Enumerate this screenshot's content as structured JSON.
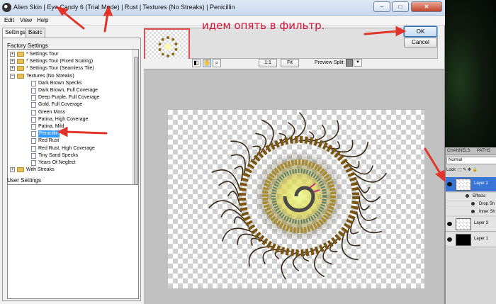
{
  "window": {
    "title": "Alien Skin | Eye Candy 6 (Trial Mode) | Rust | Textures (No Streaks) | Penicillin",
    "controls": {
      "minimize": "–",
      "maximize": "□",
      "close": "✕"
    }
  },
  "menu": {
    "items": [
      "Edit",
      "View",
      "Help"
    ]
  },
  "tabs": {
    "settings": "Settings",
    "basic": "Basic"
  },
  "factory_settings_label": "Factory Settings",
  "tree": [
    {
      "label": "* Settings Tour",
      "type": "folder",
      "expanded": false,
      "level": 0
    },
    {
      "label": "* Settings Tour (Fixed Scaling)",
      "type": "folder",
      "expanded": false,
      "level": 0
    },
    {
      "label": "* Settings Tour (Seamless Tile)",
      "type": "folder",
      "expanded": false,
      "level": 0
    },
    {
      "label": "Textures (No Streaks)",
      "type": "folder",
      "expanded": true,
      "level": 0
    },
    {
      "label": "Dark Brown Specks",
      "type": "doc",
      "level": 1
    },
    {
      "label": "Dark Brown, Full Coverage",
      "type": "doc",
      "level": 1
    },
    {
      "label": "Deep Purple, Full Coverage",
      "type": "doc",
      "level": 1
    },
    {
      "label": "Gold, Full Coverage",
      "type": "doc",
      "level": 1
    },
    {
      "label": "Green Moss",
      "type": "doc",
      "level": 1
    },
    {
      "label": "Patina, High Coverage",
      "type": "doc",
      "level": 1
    },
    {
      "label": "Patina, Mild",
      "type": "doc",
      "level": 1
    },
    {
      "label": "Penicillin",
      "type": "doc",
      "level": 1,
      "selected": true
    },
    {
      "label": "Red Rust",
      "type": "doc",
      "level": 1
    },
    {
      "label": "Red Rust, High Coverage",
      "type": "doc",
      "level": 1
    },
    {
      "label": "Tiny Sand Specks",
      "type": "doc",
      "level": 1
    },
    {
      "label": "Years Of Neglect",
      "type": "doc",
      "level": 1
    },
    {
      "label": "With Streaks",
      "type": "folder",
      "expanded": false,
      "level": 0
    }
  ],
  "user_settings_label": "User Settings",
  "annotation": "идем опять в фильтр.",
  "buttons": {
    "ok": "OK",
    "cancel": "Cancel"
  },
  "toolbar": {
    "zoom_1to1": "1:1",
    "zoom_fit": "Fit",
    "preview_split_label": "Preview Split:",
    "icons": [
      "compare-icon",
      "hand-icon",
      "zoom-icon"
    ]
  },
  "layers_panel": {
    "tabs": [
      "CHANNELS",
      "PATHS"
    ],
    "blend_mode": "Normal",
    "lock_label": "Lock:",
    "layers": [
      {
        "name": "Layer 2",
        "selected": true,
        "effects_label": "Effects",
        "effects": [
          "Drop Sh",
          "Inner Sh"
        ]
      },
      {
        "name": "Layer 3",
        "selected": false
      },
      {
        "name": "Layer 1",
        "selected": false
      }
    ]
  },
  "colors": {
    "annotation_red": "#d2143a",
    "selection_blue": "#3399ff",
    "layer_selected": "#3875d7",
    "arrow_red": "#e0352b"
  }
}
